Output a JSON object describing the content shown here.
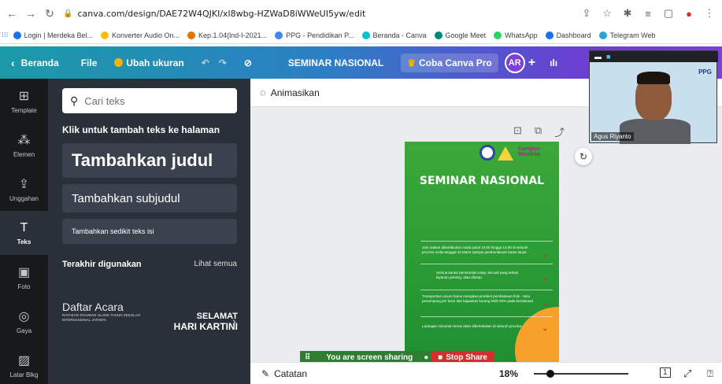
{
  "browser": {
    "url": "canva.com/design/DAE72W4QJKI/xl8wbg-HZWaD8iWWeUI5yw/edit",
    "bookmarks": [
      {
        "label": "Login | Merdeka Bel...",
        "color": "#1a73e8"
      },
      {
        "label": "Konverter Audio On...",
        "color": "#fbbc04"
      },
      {
        "label": "Kep.1.04(lnd-I-2021...",
        "color": "#e37400"
      },
      {
        "label": "PPG - Pendidikan P...",
        "color": "#4285f4"
      },
      {
        "label": "Beranda - Canva",
        "color": "#00c4cc"
      },
      {
        "label": "Google Meet",
        "color": "#00897b"
      },
      {
        "label": "WhatsApp",
        "color": "#25d366"
      },
      {
        "label": "Dashboard",
        "color": "#1a73e8"
      },
      {
        "label": "Telegram Web",
        "color": "#2aa3df"
      }
    ]
  },
  "topbar": {
    "back": "Beranda",
    "file": "File",
    "resize": "Ubah ukuran",
    "title": "SEMINAR NASIONAL",
    "pro": "Coba Canva Pro",
    "avatar": "AR",
    "plus": "+"
  },
  "rail": [
    {
      "label": "Template",
      "icon": "⊞"
    },
    {
      "label": "Elemen",
      "icon": "⁂"
    },
    {
      "label": "Unggahan",
      "icon": "⇪"
    },
    {
      "label": "Teks",
      "icon": "T"
    },
    {
      "label": "Foto",
      "icon": "▣"
    },
    {
      "label": "Gaya",
      "icon": "◎"
    },
    {
      "label": "Latar Blkg",
      "icon": "▨"
    }
  ],
  "panel": {
    "search_placeholder": "Cari teks",
    "add_text_heading": "Klik untuk tambah teks ke halaman",
    "heading_btn": "Tambahkan judul",
    "subheading_btn": "Tambahkan subjudul",
    "body_btn": "Tambahkan sedikit teks isi",
    "recent_label": "Terakhir digunakan",
    "see_all": "Lihat semua",
    "template1_title": "Daftar Acara",
    "template1_sub": "RAYAKAN TAHUNAN ULANG TAHUN SEKOLAH INTERNASIONAL JATHERI",
    "template2_a": "SELAMAT",
    "template2_b": "HARI KARTINI"
  },
  "workspace": {
    "animate": "Animasikan",
    "poster_title": "SEMINAR NASIONAL",
    "logo_text": "Kampus Merdeka",
    "items": [
      "Jam makan diberlakukan mulai pukul 10.00 hingga 14.00 di seluruh provinsi mulai tanggal 15 Maret sampai pemberlakuan batas lanjut.",
      "Semua kantor pemerintah tutup, kecuali yang terkait layanan penting, atau ditutup.",
      "Transportasi umum harus mengikuti protokol pembatasan fisik - Satu penumpang per kursi dan kapasitas kurang lebih 50% pada kendaraan.",
      "Larangan minuman keras akan diberlakukan di seluruh provinsi."
    ],
    "share_msg": "You are screen sharing",
    "stop_share": "Stop Share",
    "notes": "Catatan",
    "zoom": "18%",
    "page_num": "1"
  },
  "video": {
    "name": "Agus Riyanto",
    "brand": "PPG"
  }
}
